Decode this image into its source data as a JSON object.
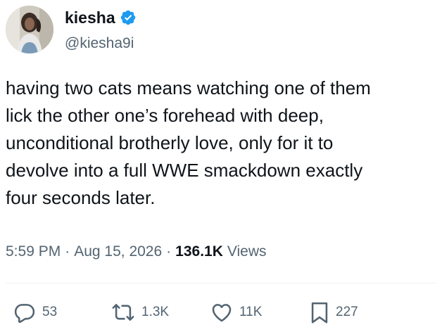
{
  "author": {
    "display_name": "kiesha",
    "handle": "@kiesha9i",
    "verified_badge_icon": "verified-badge-icon",
    "avatar": "avatar-photo"
  },
  "tweet": {
    "text": "having two cats means watching one of them\nlick the other one’s forehead with deep,\nunconditional brotherly love, only for it to\ndevolve into a full WWE smackdown exactly\nfour seconds later."
  },
  "meta": {
    "time": "5:59 PM",
    "separator1": "·",
    "date": "Aug 15, 2026",
    "separator2": "·",
    "views_count": "136.1K",
    "views_label": "Views"
  },
  "actions": {
    "reply": {
      "icon": "reply-icon",
      "count": "53"
    },
    "repost": {
      "icon": "repost-icon",
      "count": "1.3K"
    },
    "like": {
      "icon": "heart-icon",
      "count": "11K"
    },
    "bookmark": {
      "icon": "bookmark-icon",
      "count": "227"
    }
  },
  "colors": {
    "text_primary": "#0f1419",
    "text_secondary": "#536471",
    "verified_blue": "#1d9bf0",
    "divider": "#eff3f4"
  }
}
